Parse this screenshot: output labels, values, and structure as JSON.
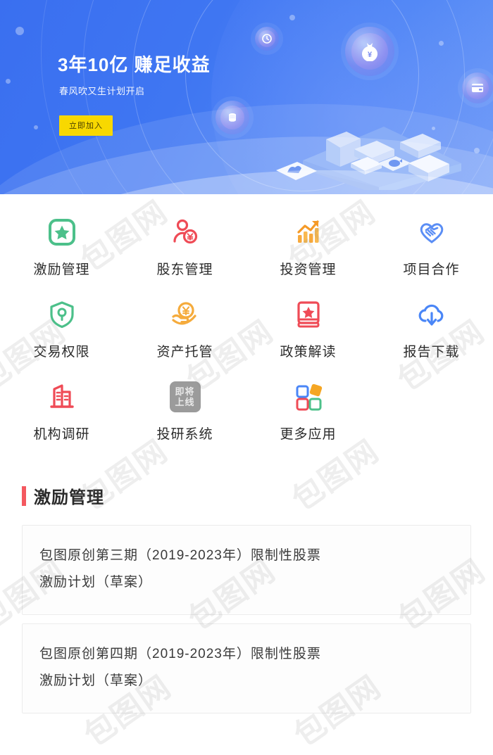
{
  "banner": {
    "title": "3年10亿  赚足收益",
    "subtitle": "春风吹又生计划开启",
    "cta_label": "立即加入",
    "cta_color": "#f8d800",
    "bg_color_start": "#3a6ff0",
    "bg_color_end": "#6f9bf7",
    "illustration": {
      "money_bag_badge": "money-bag-yen",
      "clock_badge": "clock",
      "card_badge": "bank-card",
      "coins_badge": "coin-stack",
      "platform": "isometric-platform"
    }
  },
  "grid": {
    "rows": [
      [
        {
          "label": "激励管理",
          "icon": "star-square-icon",
          "color": "#4cc08a"
        },
        {
          "label": "股东管理",
          "icon": "shareholder-person-yen-icon",
          "color": "#ef4b56"
        },
        {
          "label": "投资管理",
          "icon": "bar-chart-arrow-icon",
          "color": "#f5a623"
        },
        {
          "label": "项目合作",
          "icon": "handshake-heart-icon",
          "color": "#5b8ef5"
        }
      ],
      [
        {
          "label": "交易权限",
          "icon": "shield-key-icon",
          "color": "#4cc08a"
        },
        {
          "label": "资产托管",
          "icon": "hand-yen-coin-icon",
          "color": "#f5a623"
        },
        {
          "label": "政策解读",
          "icon": "book-star-icon",
          "color": "#ef4b56"
        },
        {
          "label": "报告下载",
          "icon": "cloud-download-icon",
          "color": "#4a86f7"
        }
      ],
      [
        {
          "label": "机构调研",
          "icon": "building-icon",
          "color": "#ef4b56"
        },
        {
          "label": "投研系统",
          "icon": "coming-soon-badge-icon",
          "color": "#9b9b9b",
          "badge_line1": "即将",
          "badge_line2": "上线"
        },
        {
          "label": "更多应用",
          "icon": "four-squares-grid-icon",
          "color": "#5b8ef5"
        }
      ]
    ]
  },
  "list_section": {
    "title": "激励管理",
    "accent_color": "#f4585f",
    "items": [
      {
        "line1": "包图原创第三期（2019-2023年）限制性股票",
        "line2": "激励计划（草案）"
      },
      {
        "line1": "包图原创第四期（2019-2023年）限制性股票",
        "line2": "激励计划（草案）"
      }
    ]
  },
  "watermark": {
    "text": "包图网"
  }
}
